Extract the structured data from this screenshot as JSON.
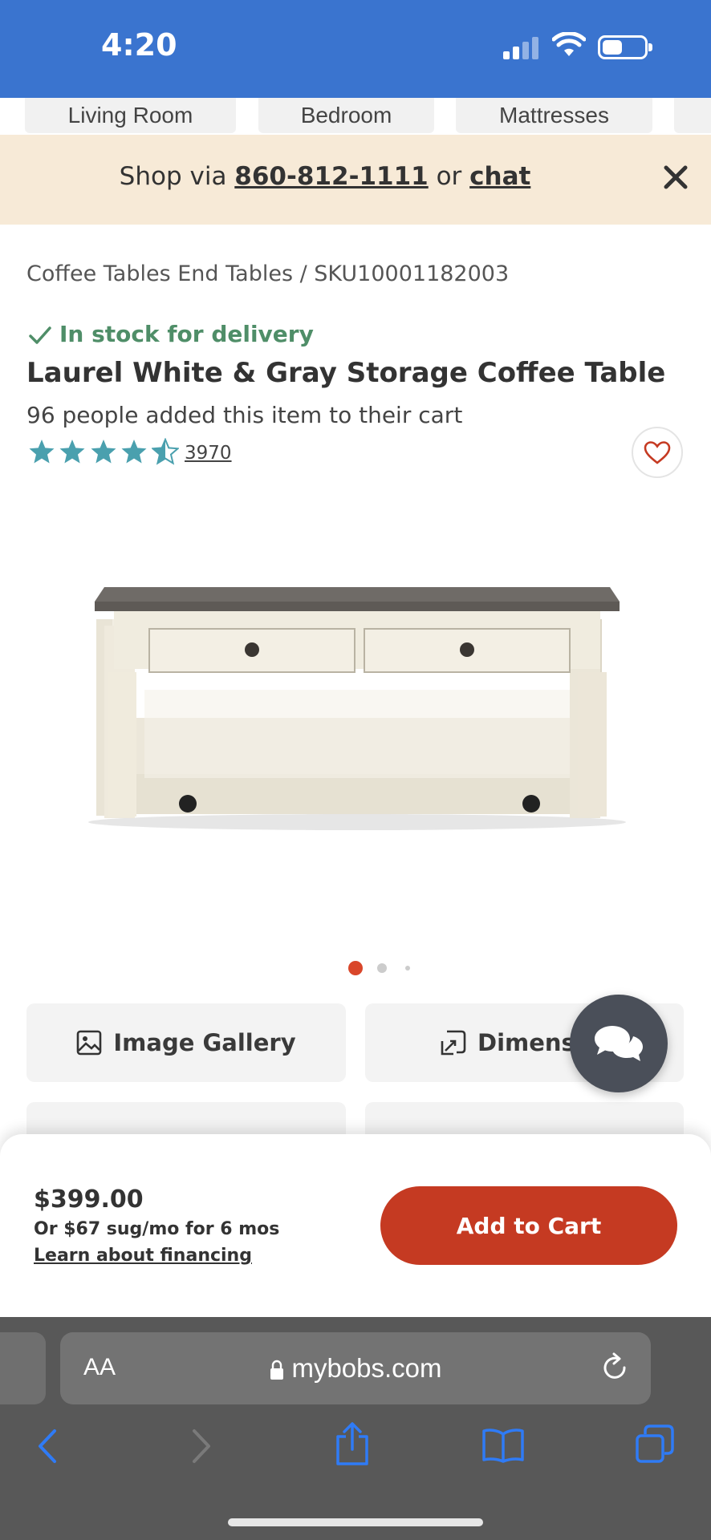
{
  "status_bar": {
    "time": "4:20"
  },
  "category_tabs": [
    "Living Room",
    "Bedroom",
    "Mattresses"
  ],
  "promo": {
    "prefix": "Shop via ",
    "phone": "860-812-1111",
    "middle": " or ",
    "chat": "chat"
  },
  "breadcrumb": "Coffee Tables End Tables /  SKU10001182003",
  "product": {
    "stock_status": "In stock for delivery",
    "title": "Laurel White & Gray Storage Coffee Table",
    "cart_count_text": "96 people added this item to their cart",
    "rating": 4.5,
    "review_count": "3970"
  },
  "carousel": {
    "active_index": 0,
    "total": 3
  },
  "actions": {
    "image_gallery": "Image Gallery",
    "dimensions": "Dimensi"
  },
  "purchase": {
    "price": "$399.00",
    "financing": "Or $67 sug/mo for 6 mos",
    "learn_financing": "Learn about financing",
    "add_to_cart": "Add to Cart"
  },
  "browser": {
    "aa_label": "AA",
    "url": "mybobs.com"
  },
  "colors": {
    "status_bar": "#3a74cf",
    "promo_bg": "#f7ead7",
    "stock_green": "#4f8e68",
    "star_teal": "#4aa0ae",
    "add_to_cart": "#c53a22",
    "carousel_active": "#d9462a",
    "safari_blue": "#2f7bf6"
  },
  "icons": [
    "signal-icon",
    "wifi-icon",
    "battery-icon",
    "close-icon",
    "checkmark-icon",
    "star-icon",
    "heart-icon",
    "image-icon",
    "dimensions-icon",
    "chat-icon",
    "lock-icon",
    "reload-icon",
    "back-icon",
    "forward-icon",
    "share-icon",
    "bookmarks-icon",
    "tabs-icon"
  ]
}
